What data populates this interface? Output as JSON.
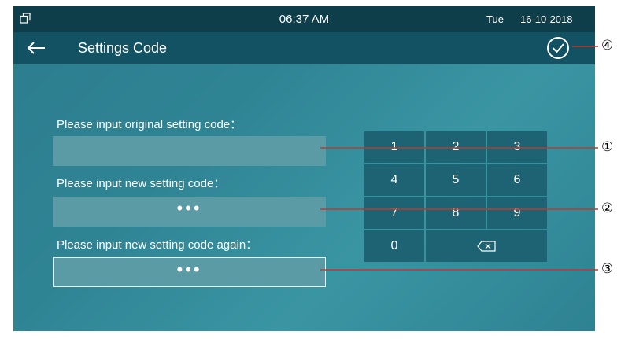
{
  "status_bar": {
    "time": "06:37 AM",
    "day": "Tue",
    "date": "16-10-2018"
  },
  "title_bar": {
    "title": "Settings Code"
  },
  "form": {
    "original_label": "Please input original setting code：",
    "original_value": "",
    "new_label": "Please input new setting code：",
    "new_value": "•••",
    "again_label": "Please input new setting code again：",
    "again_value": "•••"
  },
  "keypad": {
    "keys": [
      "1",
      "2",
      "3",
      "4",
      "5",
      "6",
      "7",
      "8",
      "9",
      "0"
    ],
    "backspace_icon": "backspace-icon"
  },
  "callouts": [
    "①",
    "②",
    "③",
    "④"
  ],
  "colors": {
    "status_bar": "#0d3e4a",
    "title_bar": "#135262",
    "key": "#1e6373",
    "field": "#5b9ba6",
    "callout_line": "#c0392b"
  }
}
